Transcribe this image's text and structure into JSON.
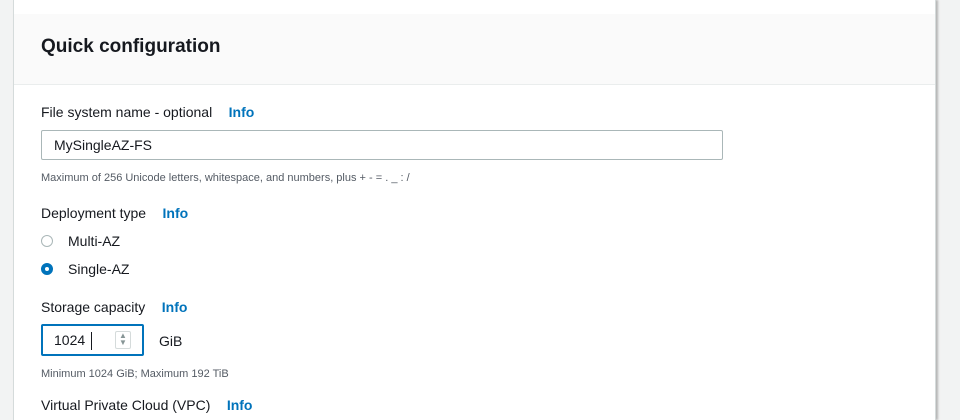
{
  "section": {
    "title": "Quick configuration"
  },
  "file_system_name": {
    "label": "File system name - optional",
    "info": "Info",
    "value": "MySingleAZ-FS",
    "hint": "Maximum of 256 Unicode letters, whitespace, and numbers, plus + - = . _ : /"
  },
  "deployment_type": {
    "label": "Deployment type",
    "info": "Info",
    "options": [
      {
        "label": "Multi-AZ",
        "selected": false
      },
      {
        "label": "Single-AZ",
        "selected": true
      }
    ]
  },
  "storage_capacity": {
    "label": "Storage capacity",
    "info": "Info",
    "value": "1024",
    "unit": "GiB",
    "hint": "Minimum 1024 GiB; Maximum 192 TiB"
  },
  "vpc": {
    "label": "Virtual Private Cloud (VPC)",
    "info": "Info"
  },
  "colors": {
    "link": "#0073bb",
    "text": "#16191f",
    "hint": "#545b64",
    "border": "#aab7b8"
  }
}
